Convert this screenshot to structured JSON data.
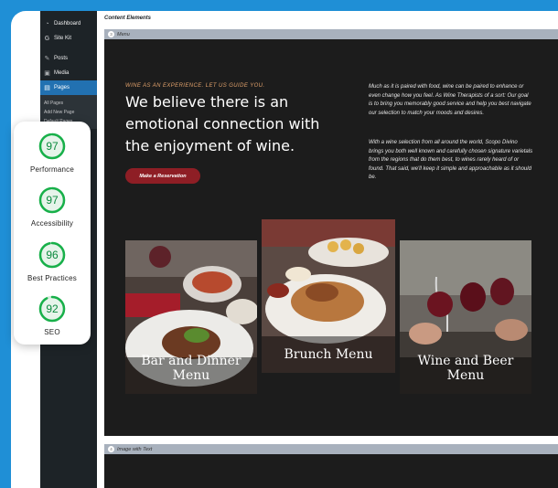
{
  "sidebar": {
    "items": [
      {
        "label": "Dashboard",
        "icon": "dashboard-icon"
      },
      {
        "label": "Site Kit",
        "icon": "google-g-icon"
      },
      {
        "label": "Posts",
        "icon": "pin-icon"
      },
      {
        "label": "Media",
        "icon": "media-icon"
      },
      {
        "label": "Pages",
        "icon": "pages-icon"
      }
    ],
    "subitems": [
      "All Pages",
      "Add New Page",
      "Default Pages"
    ]
  },
  "editor": {
    "title": "Content Elements",
    "section1": {
      "number": "3",
      "label": "Menu"
    },
    "section2": {
      "number": "4",
      "label": "Image with Text"
    }
  },
  "hero": {
    "eyebrow": "WINE AS AN EXPERIENCE. LET US GUIDE YOU.",
    "headline": "We believe there is an emotional connection with the enjoyment of wine.",
    "cta": "Make a Reservation",
    "paragraph1": "Much as it is paired with food, wine can be paired to enhance or even change how you feel. As Wine Therapists of a sort: Our goal is to bring you memorably good service and help you best navigate our selection to match your moods and desires.",
    "paragraph2": "With a wine selection from all around the world, Scopo Divino brings you both well known and carefully chosen signature varietals from the regions that do them best, to wines rarely heard of or found. That said, we'll keep it simple and approachable as it should be."
  },
  "menus": [
    {
      "label": "Bar and Dinner Menu"
    },
    {
      "label": "Brunch Menu"
    },
    {
      "label": "Wine and Beer Menu"
    }
  ],
  "scores": [
    {
      "value": 97,
      "name": "Performance",
      "fraction": 0.97
    },
    {
      "value": 97,
      "name": "Accessibility",
      "fraction": 0.97
    },
    {
      "value": 96,
      "name": "Best Practices",
      "fraction": 0.96
    },
    {
      "value": 92,
      "name": "SEO",
      "fraction": 0.92
    }
  ],
  "colors": {
    "background": "#1f8fd6",
    "score_green": "#0b8a3e",
    "cta": "#8e1e25",
    "eyebrow": "#e0a16b"
  }
}
